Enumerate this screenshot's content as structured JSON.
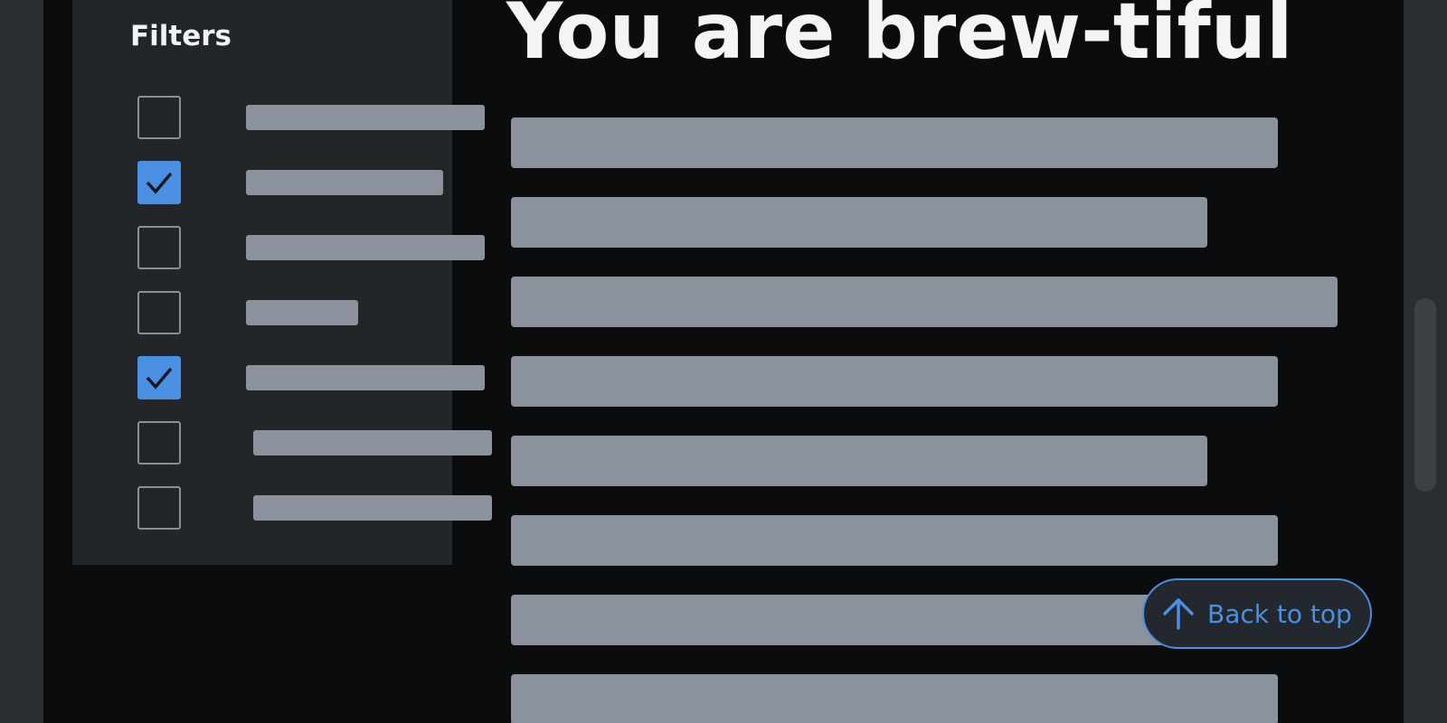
{
  "filters": {
    "title": "Filters",
    "items": [
      {
        "checked": false
      },
      {
        "checked": true
      },
      {
        "checked": false
      },
      {
        "checked": false
      },
      {
        "checked": true
      },
      {
        "checked": false
      },
      {
        "checked": false
      }
    ]
  },
  "main": {
    "headline": "You are brew-tiful"
  },
  "back_to_top": {
    "label": "Back to top",
    "icon": "arrow-up-icon"
  },
  "colors": {
    "accent": "#4a8fe2",
    "page_background": "#0b0c0d",
    "panel_background": "#232629",
    "placeholder": "#8c929b"
  }
}
